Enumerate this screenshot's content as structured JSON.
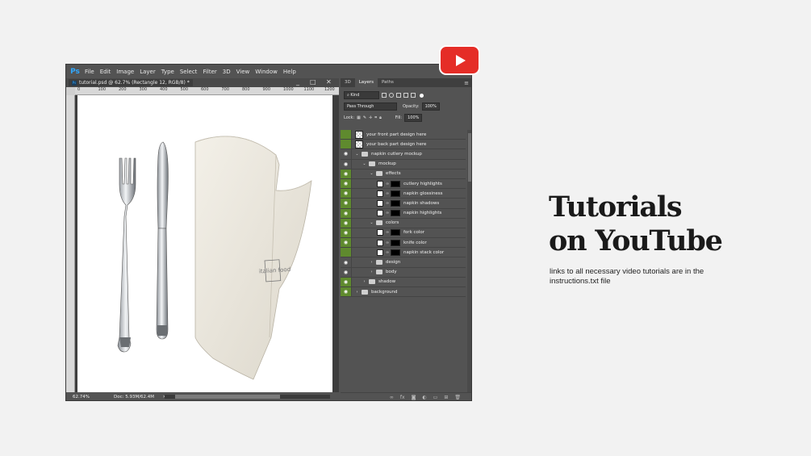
{
  "photoshop": {
    "menu": [
      "File",
      "Edit",
      "Image",
      "Layer",
      "Type",
      "Select",
      "Filter",
      "3D",
      "View",
      "Window",
      "Help"
    ],
    "doc_title": "tutorial.psd @ 62.7% (Rectangle 12, RGB/8) *",
    "ruler_ticks": [
      "0",
      "100",
      "200",
      "300",
      "400",
      "500",
      "600",
      "700",
      "800",
      "900",
      "1000",
      "1100",
      "1200"
    ],
    "status_zoom": "62.74%",
    "status_doc": "Doc: 5.93M/62.4M",
    "panel_tabs": [
      "3D",
      "Layers",
      "Paths"
    ],
    "filter_kind": "Kind",
    "blend_mode": "Pass Through",
    "opacity_label": "Opacity:",
    "opacity_value": "100%",
    "lock_label": "Lock:",
    "fill_label": "Fill:",
    "fill_value": "100%",
    "layers": [
      {
        "name": "your front part design here",
        "type": "smart",
        "indent": 0,
        "visible": false,
        "green": true
      },
      {
        "name": "your back part design here",
        "type": "smart",
        "indent": 0,
        "visible": false,
        "green": true
      },
      {
        "name": "napkin cutlery mockup",
        "type": "group",
        "indent": 0,
        "visible": true,
        "green": false
      },
      {
        "name": "mockup",
        "type": "group",
        "indent": 1,
        "visible": true,
        "green": false
      },
      {
        "name": "effects",
        "type": "group",
        "indent": 2,
        "visible": true,
        "green": true
      },
      {
        "name": "cutlery highlights",
        "type": "layer",
        "indent": 3,
        "visible": true,
        "green": true,
        "thumb": "white"
      },
      {
        "name": "napkin glossiness",
        "type": "layer",
        "indent": 3,
        "visible": true,
        "green": true,
        "thumb": "white"
      },
      {
        "name": "napkin shadows",
        "type": "layer",
        "indent": 3,
        "visible": true,
        "green": true,
        "thumb": "black"
      },
      {
        "name": "napkin highlights",
        "type": "layer",
        "indent": 3,
        "visible": true,
        "green": true,
        "thumb": "white"
      },
      {
        "name": "colors",
        "type": "group",
        "indent": 2,
        "visible": true,
        "green": true
      },
      {
        "name": "fork color",
        "type": "layer",
        "indent": 3,
        "visible": true,
        "green": true,
        "thumb": "white"
      },
      {
        "name": "knife color",
        "type": "layer",
        "indent": 3,
        "visible": true,
        "green": true,
        "thumb": "white"
      },
      {
        "name": "napkin stack color",
        "type": "layer",
        "indent": 3,
        "visible": false,
        "green": true,
        "thumb": "white"
      },
      {
        "name": "design",
        "type": "group",
        "indent": 2,
        "visible": true,
        "green": false,
        "collapsed": true
      },
      {
        "name": "body",
        "type": "group",
        "indent": 2,
        "visible": true,
        "green": false,
        "collapsed": true
      },
      {
        "name": "shadow",
        "type": "group",
        "indent": 1,
        "visible": true,
        "green": true,
        "collapsed": true
      },
      {
        "name": "background",
        "type": "group",
        "indent": 0,
        "visible": true,
        "green": true,
        "collapsed": true
      }
    ],
    "napkin_logo": "italian food"
  },
  "promo": {
    "headline_line1": "Tutorials",
    "headline_line2": "on YouTube",
    "description": "links to all necessary video tutorials are in the instructions.txt file"
  },
  "colors": {
    "accent_green": "#5f8a2e",
    "youtube_red": "#e52d27",
    "ps_gray": "#535353"
  }
}
